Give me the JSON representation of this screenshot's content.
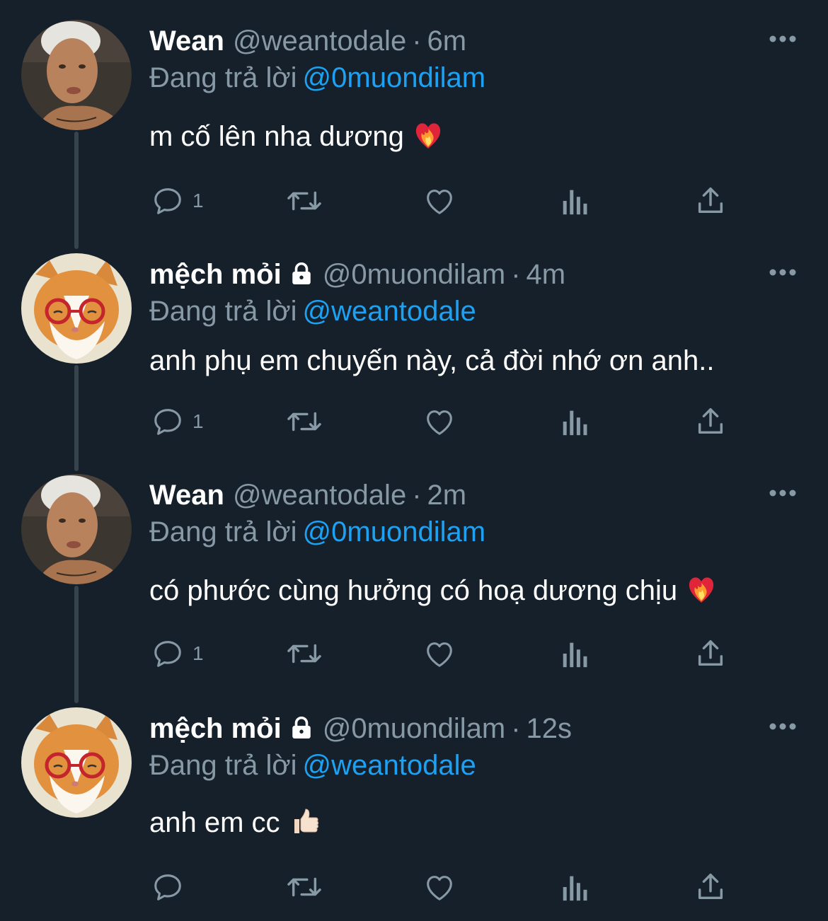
{
  "colors": {
    "background": "#15202b",
    "text": "#ffffff",
    "secondary": "#8899a6",
    "accent": "#1da1f2",
    "thread_line": "#38444d"
  },
  "common": {
    "replying_label": "Đang trả lời"
  },
  "tweets": [
    {
      "name": "Wean",
      "locked": false,
      "handle": "@weantodale",
      "separator": "·",
      "time": "6m",
      "reply_to": "@0muondilam",
      "text": "m cố lên nha dương",
      "emoji": "heart-on-fire",
      "reply_count": "1",
      "avatar": "person-avatar"
    },
    {
      "name": "mệch mỏi",
      "locked": true,
      "handle": "@0muondilam",
      "separator": "·",
      "time": "4m",
      "reply_to": "@weantodale",
      "text": "anh phụ em chuyến này, cả đời nhớ ơn anh..",
      "emoji": "",
      "reply_count": "1",
      "avatar": "cat-avatar"
    },
    {
      "name": "Wean",
      "locked": false,
      "handle": "@weantodale",
      "separator": "·",
      "time": "2m",
      "reply_to": "@0muondilam",
      "text": "có phước cùng hưởng có hoạ dương chịu",
      "emoji": "heart-on-fire",
      "reply_count": "1",
      "avatar": "person-avatar"
    },
    {
      "name": "mệch mỏi",
      "locked": true,
      "handle": "@0muondilam",
      "separator": "·",
      "time": "12s",
      "reply_to": "@weantodale",
      "text": "anh em cc",
      "emoji": "thumbs-up",
      "reply_count": "",
      "avatar": "cat-avatar"
    }
  ]
}
